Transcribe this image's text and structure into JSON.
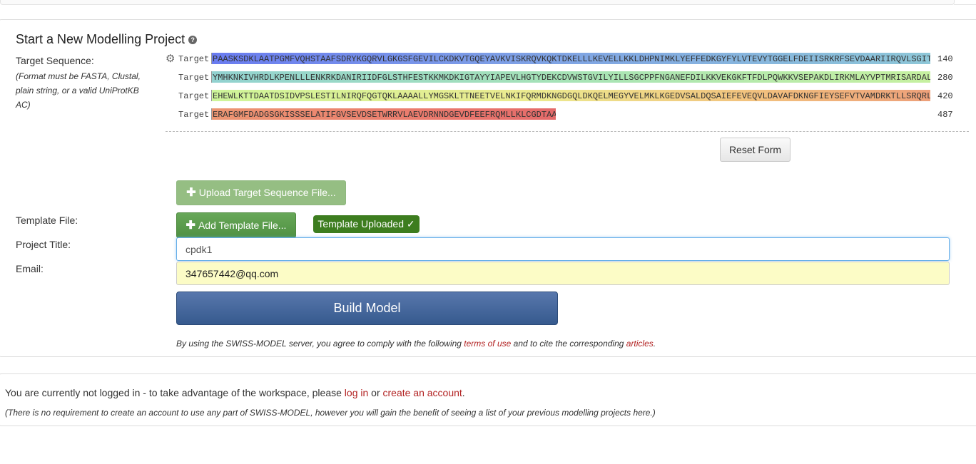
{
  "header": {
    "title": "Start a New Modelling Project",
    "help_icon": "?"
  },
  "target": {
    "label": "Target Sequence:",
    "hint": "(Format must be FASTA, Clustal, plain string, or a valid UniProtKB AC)",
    "gear_icon": "gear-icon",
    "rows": [
      {
        "label": "Target",
        "sequence": "PAASKSDKLAATPGMFVQHSTAAFSDRYKGQRVLGKGSFGEVILCKDKVTGQEYAVKVISKRQVKQKTDKELLLKEVELLKKLDHPNIMKLYEFFEDKGYFYLVTEVYTGGELFDEIISRKRFSEVDAARIIRQVLSGIT",
        "end": "140"
      },
      {
        "label": "Target",
        "sequence": "YMHKNKIVHRDLKPENLLLENKRKDANIRIIDFGLSTHFESTKKMKDKIGTAYYIAPEVLHGTYDEKCDVWSTGVILYILLSGCPPFNGANEFDILKKVEKGKFTFDLPQWKKVSEPAKDLIRKMLAYVPTMRISARDAL",
        "end": "280"
      },
      {
        "label": "Target",
        "sequence": "EHEWLKTTDAATDSIDVPSLESTILNIRQFQGTQKLAAAALLYMGSKLTTNEETVELNKIFQRMDKNGDGQLDKQELMEGYVELMKLKGEDVSALDQSAIEFEVEQVLDAVAFDKNGFIEYSEFVTVAMDRKTLLSRQRL",
        "end": "420"
      },
      {
        "label": "Target",
        "sequence": "ERAFGMFDADGSGKISSSELATIFGVSEVDSETWRRVLAEVDRNNDGEVDFEEFRQMLLKLCGDTAA",
        "end": "487"
      }
    ]
  },
  "buttons": {
    "reset": "Reset Form",
    "upload_target": "Upload Target Sequence File...",
    "add_template": "Add Template File...",
    "build": "Build Model"
  },
  "template": {
    "label": "Template File:",
    "status": "Template Uploaded ✓"
  },
  "project": {
    "label": "Project Title:",
    "value": "cpdk1"
  },
  "email": {
    "label": "Email:",
    "value": "347657442@qq.com"
  },
  "terms": {
    "prefix": "By using the SWISS-MODEL server, you agree to comply with the following ",
    "terms_link": "terms of use",
    "middle": " and to cite the corresponding ",
    "articles_link": "articles",
    "suffix": "."
  },
  "login": {
    "prefix": "You are currently not logged in - to take advantage of the workspace, please ",
    "login_link": "log in",
    "middle": " or ",
    "create_link": "create an account",
    "suffix": ".",
    "note": "(There is no requirement to create an account to use any part of SWISS-MODEL, however you will gain the benefit of seeing a list of your previous modelling projects here.)"
  },
  "colors": {
    "link": "#b22222",
    "build_button": "#3f6399",
    "add_button": "#5a9b4c",
    "uploaded_badge": "#3d7d1f",
    "email_bg": "#fcfcc6"
  }
}
